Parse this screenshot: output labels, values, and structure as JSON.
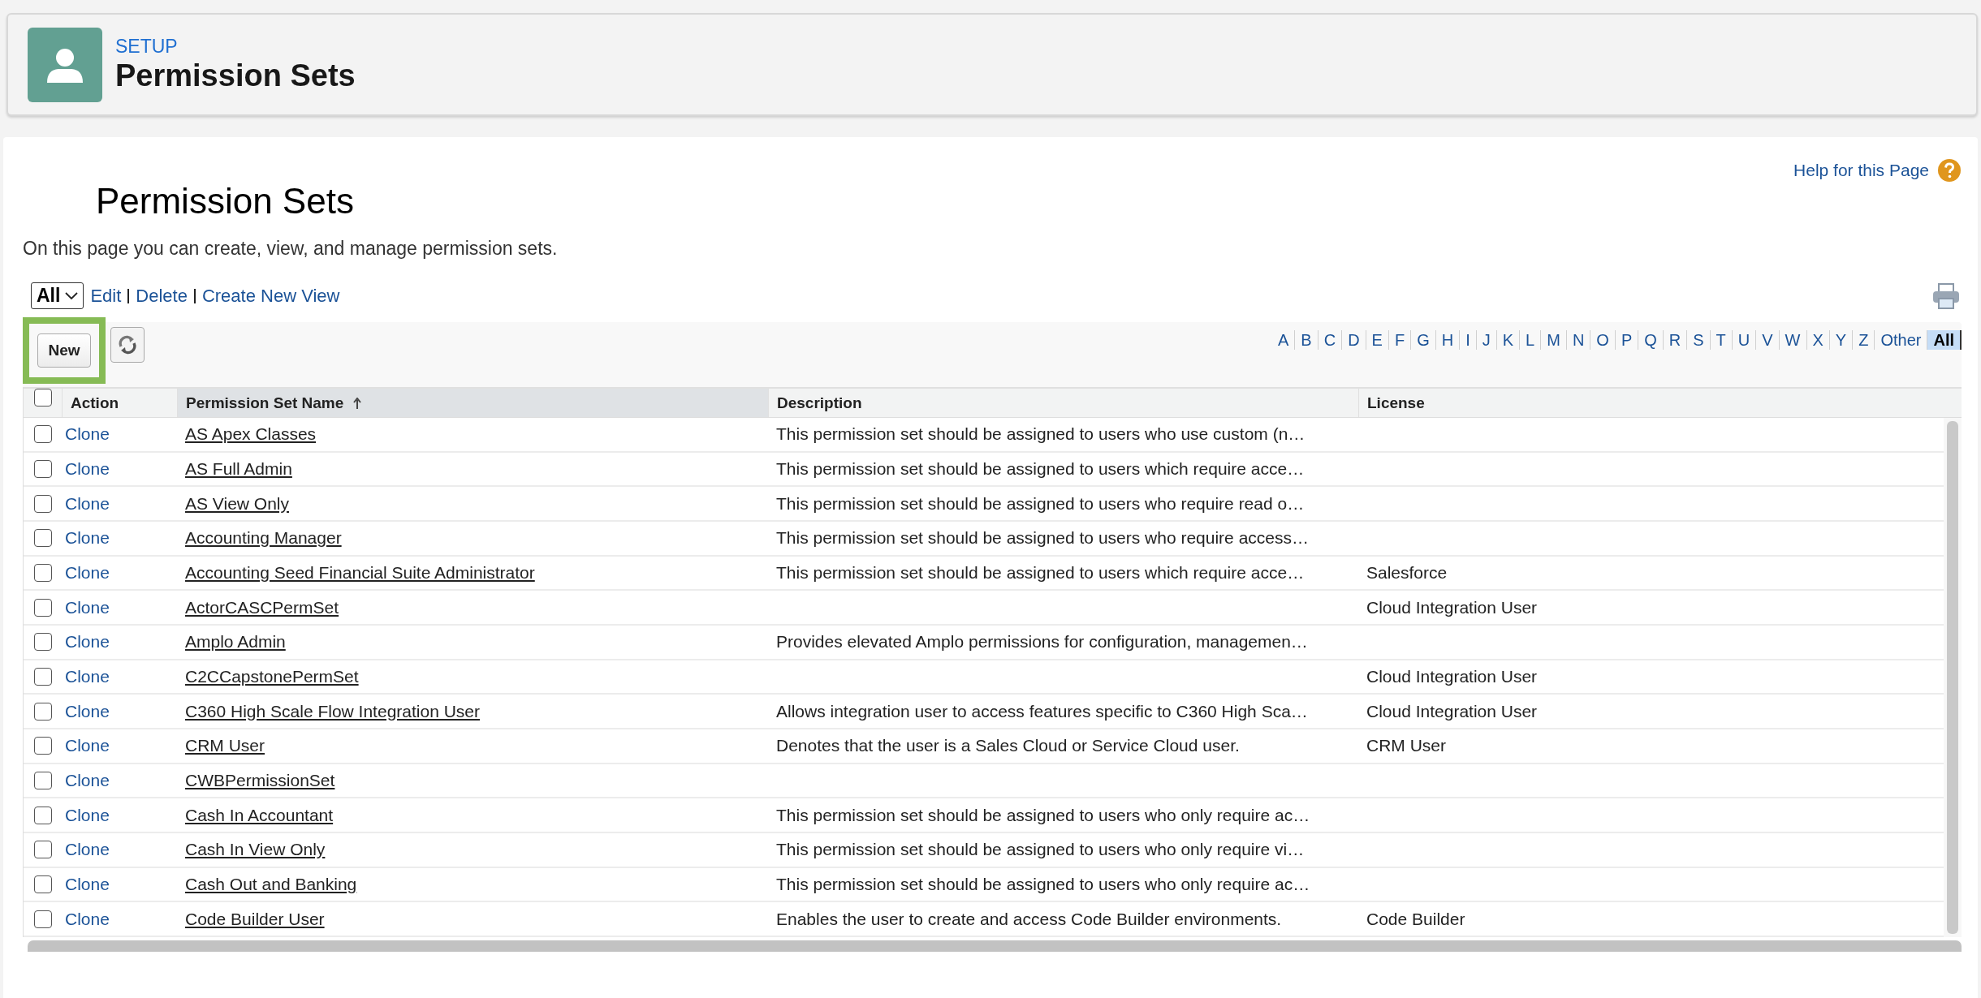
{
  "header": {
    "breadcrumb": "SETUP",
    "title": "Permission Sets"
  },
  "page": {
    "title": "Permission Sets",
    "help_link": "Help for this Page",
    "description": "On this page you can create, view, and manage permission sets."
  },
  "view": {
    "selected": "All",
    "links": [
      "Edit",
      "Delete",
      "Create New View"
    ]
  },
  "toolbar": {
    "new_button": "New",
    "highlighted": true
  },
  "alphabet": [
    {
      "label": "A",
      "selected": false
    },
    {
      "label": "B",
      "selected": false
    },
    {
      "label": "C",
      "selected": false
    },
    {
      "label": "D",
      "selected": false
    },
    {
      "label": "E",
      "selected": false
    },
    {
      "label": "F",
      "selected": false
    },
    {
      "label": "G",
      "selected": false
    },
    {
      "label": "H",
      "selected": false
    },
    {
      "label": "I",
      "selected": false
    },
    {
      "label": "J",
      "selected": false
    },
    {
      "label": "K",
      "selected": false
    },
    {
      "label": "L",
      "selected": false
    },
    {
      "label": "M",
      "selected": false
    },
    {
      "label": "N",
      "selected": false
    },
    {
      "label": "O",
      "selected": false
    },
    {
      "label": "P",
      "selected": false
    },
    {
      "label": "Q",
      "selected": false
    },
    {
      "label": "R",
      "selected": false
    },
    {
      "label": "S",
      "selected": false
    },
    {
      "label": "T",
      "selected": false
    },
    {
      "label": "U",
      "selected": false
    },
    {
      "label": "V",
      "selected": false
    },
    {
      "label": "W",
      "selected": false
    },
    {
      "label": "X",
      "selected": false
    },
    {
      "label": "Y",
      "selected": false
    },
    {
      "label": "Z",
      "selected": false
    },
    {
      "label": "Other",
      "selected": false
    },
    {
      "label": "All",
      "selected": true
    }
  ],
  "table": {
    "select_all_checked": false,
    "columns": [
      {
        "label": "Action",
        "sorted": false
      },
      {
        "label": "Permission Set Name",
        "sorted": true
      },
      {
        "label": "Description",
        "sorted": false
      },
      {
        "label": "License",
        "sorted": false
      }
    ],
    "rows": [
      {
        "checked": false,
        "action": "Clone",
        "name": "AS Apex Classes",
        "description": "This permission set should be assigned to users who use custom (n…"
      },
      {
        "checked": false,
        "action": "Clone",
        "name": "AS Full Admin",
        "description": "This permission set should be assigned to users which require acce…"
      },
      {
        "checked": false,
        "action": "Clone",
        "name": "AS View Only",
        "description": "This permission set should be assigned to users who require read o…"
      },
      {
        "checked": false,
        "action": "Clone",
        "name": "Accounting Manager",
        "description": "This permission set should be assigned to users who require access…"
      },
      {
        "checked": false,
        "action": "Clone",
        "name": "Accounting Seed Financial Suite Administrator",
        "description": "This permission set should be assigned to users which require acce…",
        "license": "Salesforce"
      },
      {
        "checked": false,
        "action": "Clone",
        "name": "ActorCASCPermSet",
        "license": "Cloud Integration User"
      },
      {
        "checked": false,
        "action": "Clone",
        "name": "Amplo Admin",
        "description": "Provides elevated Amplo permissions for configuration, managemen…"
      },
      {
        "checked": false,
        "action": "Clone",
        "name": "C2CCapstonePermSet",
        "license": "Cloud Integration User"
      },
      {
        "checked": false,
        "action": "Clone",
        "name": "C360 High Scale Flow Integration User",
        "description": "Allows integration user to access features specific to C360 High Sca…",
        "license": "Cloud Integration User"
      },
      {
        "checked": false,
        "action": "Clone",
        "name": "CRM User",
        "description": "Denotes that the user is a Sales Cloud or Service Cloud user.",
        "license": "CRM User"
      },
      {
        "checked": false,
        "action": "Clone",
        "name": "CWBPermissionSet"
      },
      {
        "checked": false,
        "action": "Clone",
        "name": "Cash In Accountant",
        "description": "This permission set should be assigned to users who only require ac…"
      },
      {
        "checked": false,
        "action": "Clone",
        "name": "Cash In View Only",
        "description": "This permission set should be assigned to users who only require vi…"
      },
      {
        "checked": false,
        "action": "Clone",
        "name": "Cash Out and Banking",
        "description": "This permission set should be assigned to users who only require ac…"
      },
      {
        "checked": false,
        "action": "Clone",
        "name": "Code Builder User",
        "description": "Enables the user to create and access Code Builder environments.",
        "license": "Code Builder"
      }
    ]
  }
}
